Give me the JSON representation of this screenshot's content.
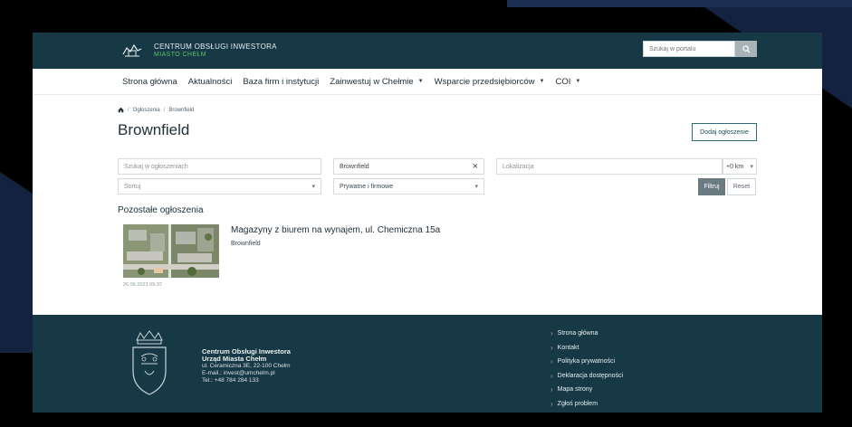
{
  "header": {
    "brand_title": "CENTRUM OBSŁUGI INWESTORA",
    "brand_sub": "MIASTO CHEŁM",
    "search_placeholder": "Szukaj w portalu"
  },
  "nav": {
    "items": [
      {
        "label": "Strona główna",
        "caret": false
      },
      {
        "label": "Aktualności",
        "caret": false
      },
      {
        "label": "Baza firm i instytucji",
        "caret": false
      },
      {
        "label": "Zainwestuj w Chełmie",
        "caret": true
      },
      {
        "label": "Wsparcie przedsiębiorców",
        "caret": true
      },
      {
        "label": "COI",
        "caret": true
      }
    ]
  },
  "breadcrumb": {
    "level1": "Ogłoszenia",
    "level2": "Brownfield"
  },
  "page": {
    "title": "Brownfield",
    "add_button": "Dodaj ogłoszenie"
  },
  "filters": {
    "search_placeholder": "Szukaj w ogłoszeniach",
    "category_value": "Brownfield",
    "location_placeholder": "Lokalizacja",
    "radius_value": "+0 km",
    "sort_placeholder": "Sortuj",
    "type_value": "Prywatne i firmowe",
    "filter_button": "Filtruj",
    "reset_button": "Reset"
  },
  "listings": {
    "section_title": "Pozostałe ogłoszenia",
    "items": [
      {
        "title": "Magazyny z biurem na wynajem, ul. Chemiczna 15a",
        "tag": "Brownfield",
        "date": "26.06.2023 09:37"
      }
    ]
  },
  "footer": {
    "org_name": "Centrum Obsługi Inwestora",
    "org_sub": "Urząd Miasta Chełm",
    "address": "ul. Ceramiczna 3E, 22-100 Chełm",
    "email": "E-mail.: invest@umchelm.pl",
    "phone": "Tel.: +48 784 284 133",
    "links": [
      "Strona główna",
      "Kontakt",
      "Polityka prywatności",
      "Deklaracja dostępności",
      "Mapa strony",
      "Zgłoś problem"
    ]
  },
  "colors": {
    "header_bg": "#173845",
    "footer_bg": "#173845",
    "accent_green": "#5fbf6a",
    "filter_button_bg": "#6c7a82"
  }
}
